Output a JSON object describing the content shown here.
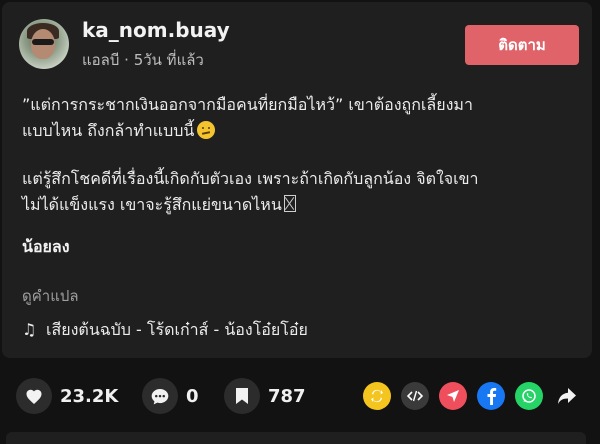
{
  "post": {
    "username": "ka_nom.buay",
    "meta": "แอลบี · 5วัน ที่แล้ว",
    "follow_label": "ติดตาม",
    "line1": "”แต่การกระชากเงินออกจากมือคนที่ยกมือไหว้” เขาต้องถูกเลี้ยงมา",
    "line2": "แบบไหน ถึงกล้าทำแบบนี้",
    "line3": "แต่รู้สึกโชคดีที่เรื่องนี้เกิดกับตัวเอง เพราะถ้าเกิดกับลูกน้อง จิตใจเขา",
    "line4": "ไม่ได้แข็งแรง เขาจะรู้สึกแย่ขนาดไหน",
    "less_label": "น้อยลง",
    "translate_label": "ดูคำแปล",
    "music_note": "♫",
    "music": "เสียงต้นฉบับ - โร้ดเก๋าส์ - น้องโอ๋ยโอ๋ย"
  },
  "stats": {
    "likes": "23.2K",
    "comments": "0",
    "saves": "787"
  },
  "icons": {
    "thinking_emoji": "thinking-face-emoji",
    "like": "heart-icon",
    "comment": "comment-bubble-icon",
    "save": "bookmark-icon",
    "repost": "repost-icon",
    "embed": "embed-code-icon",
    "send": "send-icon",
    "facebook": "facebook-icon",
    "whatsapp": "whatsapp-icon",
    "forward": "share-arrow-icon"
  },
  "colors": {
    "background": "#121212",
    "card": "#1f1f1f",
    "follow_button": "#e0636a",
    "repost": "#f4c51f",
    "send": "#ef4f5d",
    "facebook": "#1877f2",
    "whatsapp": "#25d366"
  }
}
